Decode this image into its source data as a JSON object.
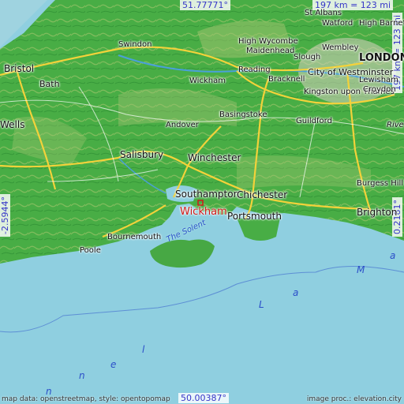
{
  "coords": {
    "lat_north": "51.77771°",
    "lat_south": "50.00387°",
    "lon_west": "-2.5944°",
    "lon_east": "0.2181°",
    "scale_horizontal": "197 km = 123 mi",
    "scale_vertical": "197 km = 123 mi"
  },
  "highlight": {
    "label": "Wickham"
  },
  "places": {
    "st_albans": "St Albans",
    "watford": "Watford",
    "high_barnet": "High Barnet",
    "swindon": "Swindon",
    "high_wycombe": "High Wycombe",
    "maidenhead": "Maidenhead",
    "slough": "Slough",
    "wembley": "Wembley",
    "london": "LONDON",
    "bristol": "Bristol",
    "city_of_westminster": "City of Westminster",
    "bath": "Bath",
    "wickham_north": "Wickham",
    "reading": "Reading",
    "bracknell": "Bracknell",
    "lewisham": "Lewisham",
    "kingston": "Kingston upon Thames",
    "croydon": "Croydon",
    "basingstoke": "Basingstoke",
    "guildford": "Guildford",
    "wells": "Wells",
    "andover": "Andover",
    "salisbury": "Salisbury",
    "winchester": "Winchester",
    "burgess_hill": "Burgess Hill",
    "southampton": "Southampton",
    "chichester": "Chichester",
    "brighton": "Brighton",
    "portsmouth": "Portsmouth",
    "bournemouth": "Bournemouth",
    "poole": "Poole",
    "the_solent": "The Solent",
    "river": "Rive"
  },
  "sea_letters": [
    "n",
    "n",
    "e",
    "l",
    "L",
    "a",
    "M",
    "a"
  ],
  "credits": {
    "left": "map data: openstreetmap, style: opentopomap",
    "right": "image proc.: elevation.city"
  },
  "colors": {
    "sea": "#8fcfe0",
    "land_low": "#3fa93f",
    "land_high": "#9cc26e",
    "road_major": "#f3d23a",
    "highlight": "#d01818",
    "coord_text": "#3535c8"
  }
}
